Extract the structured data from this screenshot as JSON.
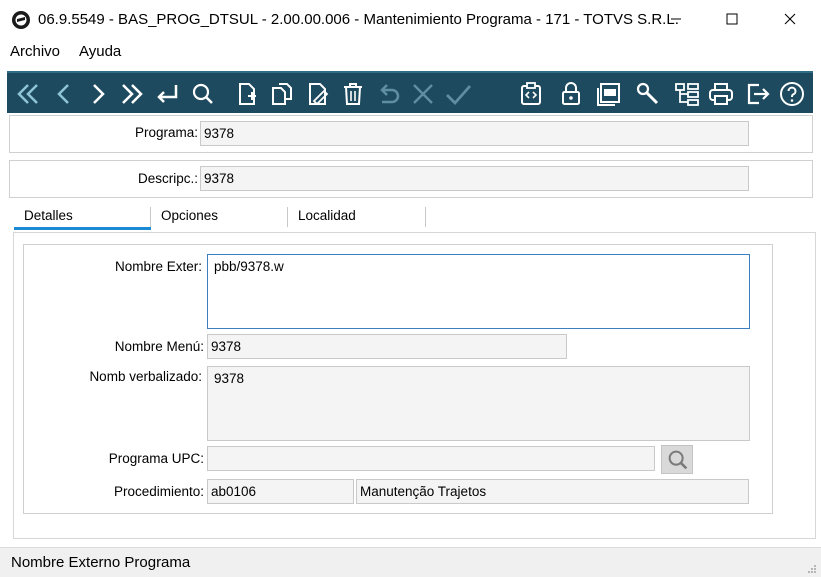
{
  "window": {
    "title": "06.9.5549 - BAS_PROG_DTSUL - 2.00.00.006 - Mantenimiento Programa - 171 - TOTVS S.R.L."
  },
  "menu": {
    "items": [
      "Archivo",
      "Ayuda"
    ]
  },
  "toolbar": {
    "background": "#1d4a5e",
    "icons": [
      "first-record-icon",
      "previous-record-icon",
      "next-record-icon",
      "last-record-icon",
      "goto-icon",
      "search-icon",
      "new-document-icon",
      "copy-icon",
      "edit-icon",
      "delete-icon",
      "undo-icon",
      "cancel-icon",
      "confirm-icon",
      "code-icon",
      "lock-icon",
      "pdf-icon",
      "tools-icon",
      "tree-icon",
      "print-icon",
      "exit-icon",
      "help-icon"
    ]
  },
  "header": {
    "programa_label": "Programa:",
    "programa_value": "9378",
    "descripc_label": "Descripc.:",
    "descripc_value": "9378"
  },
  "tabs": [
    "Detalles",
    "Opciones",
    "Localidad"
  ],
  "details": {
    "nombre_exter_label": "Nombre Exter:",
    "nombre_exter_value": "pbb/9378.w",
    "nombre_menu_label": "Nombre Menú:",
    "nombre_menu_value": "9378",
    "nomb_verbalizado_label": "Nomb verbalizado:",
    "nomb_verbalizado_value": "9378",
    "programa_upc_label": "Programa UPC:",
    "programa_upc_value": "",
    "procedimiento_label": "Procedimiento:",
    "procedimiento_code": "ab0106",
    "procedimiento_desc": "Manutenção Trajetos"
  },
  "status": {
    "text": "Nombre Externo Programa"
  },
  "colors": {
    "accent": "#1a8ad4",
    "toolbar": "#1d4a5e",
    "focus_border": "#3c7fc1"
  }
}
